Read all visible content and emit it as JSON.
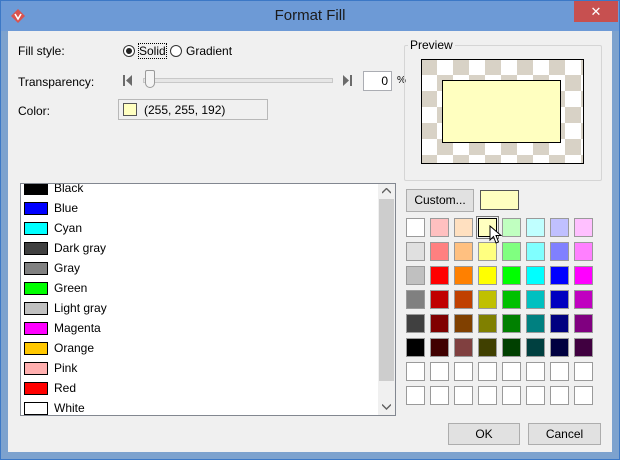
{
  "window": {
    "title": "Format Fill",
    "close_symbol": "✕",
    "app_icon": "visual-paradigm-icon"
  },
  "fill_style": {
    "label": "Fill style:",
    "options": [
      "Solid",
      "Gradient"
    ],
    "selected": "Solid"
  },
  "transparency": {
    "label": "Transparency:",
    "value": "0",
    "unit": "%",
    "level": 0
  },
  "color": {
    "label": "Color:",
    "value_text": "(255, 255, 192)",
    "hex": "#ffffc0"
  },
  "preview": {
    "label": "Preview"
  },
  "color_list": [
    {
      "name": "Black",
      "hex": "#000000"
    },
    {
      "name": "Blue",
      "hex": "#0000ff"
    },
    {
      "name": "Cyan",
      "hex": "#00ffff"
    },
    {
      "name": "Dark gray",
      "hex": "#404040"
    },
    {
      "name": "Gray",
      "hex": "#808080"
    },
    {
      "name": "Green",
      "hex": "#00ff00"
    },
    {
      "name": "Light gray",
      "hex": "#c0c0c0"
    },
    {
      "name": "Magenta",
      "hex": "#ff00ff"
    },
    {
      "name": "Orange",
      "hex": "#ffc800"
    },
    {
      "name": "Pink",
      "hex": "#ffafaf"
    },
    {
      "name": "Red",
      "hex": "#ff0000"
    },
    {
      "name": "White",
      "hex": "#ffffff"
    }
  ],
  "custom": {
    "button_label": "Custom...",
    "current_hex": "#ffffc0"
  },
  "palette": [
    [
      "#ffffff",
      "#ffc0c0",
      "#ffe0c0",
      "#ffffc0",
      "#c0ffc0",
      "#c0ffff",
      "#c0c0ff",
      "#ffc0ff"
    ],
    [
      "#e0e0e0",
      "#ff8080",
      "#ffc080",
      "#ffff80",
      "#80ff80",
      "#80ffff",
      "#8080ff",
      "#ff80ff"
    ],
    [
      "#c0c0c0",
      "#ff0000",
      "#ff8000",
      "#ffff00",
      "#00ff00",
      "#00ffff",
      "#0000ff",
      "#ff00ff"
    ],
    [
      "#808080",
      "#c00000",
      "#c04000",
      "#c0c000",
      "#00c000",
      "#00c0c0",
      "#0000c0",
      "#c000c0"
    ],
    [
      "#404040",
      "#800000",
      "#804000",
      "#808000",
      "#008000",
      "#008080",
      "#000080",
      "#800080"
    ],
    [
      "#000000",
      "#400000",
      "#804040",
      "#404000",
      "#004000",
      "#004040",
      "#000040",
      "#400040"
    ],
    [
      "#ffffff",
      "#ffffff",
      "#ffffff",
      "#ffffff",
      "#ffffff",
      "#ffffff",
      "#ffffff",
      "#ffffff"
    ],
    [
      "#ffffff",
      "#ffffff",
      "#ffffff",
      "#ffffff",
      "#ffffff",
      "#ffffff",
      "#ffffff",
      "#ffffff"
    ]
  ],
  "palette_selected": [
    0,
    3
  ],
  "buttons": {
    "ok": "OK",
    "cancel": "Cancel"
  }
}
